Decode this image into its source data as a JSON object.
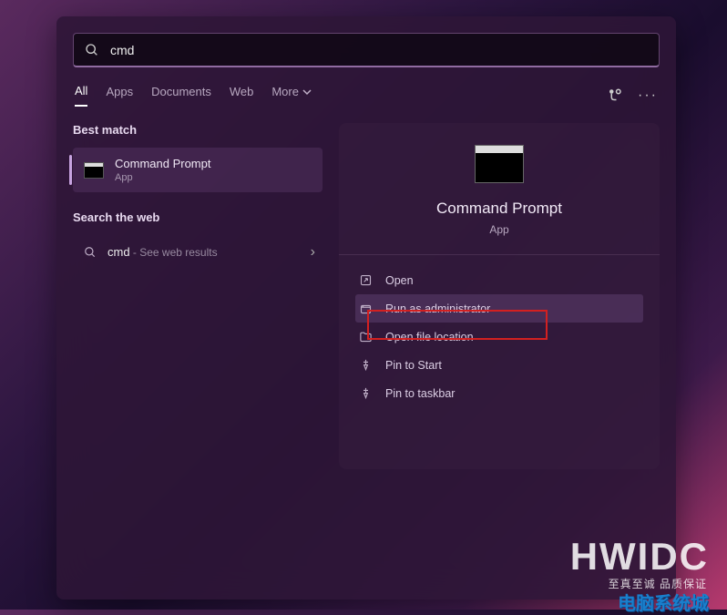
{
  "search": {
    "query": "cmd"
  },
  "tabs": {
    "items": [
      "All",
      "Apps",
      "Documents",
      "Web",
      "More"
    ],
    "active_index": 0
  },
  "sections": {
    "best_match": "Best match",
    "search_web": "Search the web"
  },
  "best_match_result": {
    "title": "Command Prompt",
    "subtitle": "App"
  },
  "web_result": {
    "query": "cmd",
    "suffix": " - See web results"
  },
  "preview": {
    "title": "Command Prompt",
    "subtitle": "App"
  },
  "actions": {
    "open": "Open",
    "run_admin": "Run as administrator",
    "open_location": "Open file location",
    "pin_start": "Pin to Start",
    "pin_taskbar": "Pin to taskbar"
  },
  "watermarks": {
    "main": "HWIDC",
    "sub": "至真至诚 品质保证",
    "secondary": "电脑系统城"
  }
}
